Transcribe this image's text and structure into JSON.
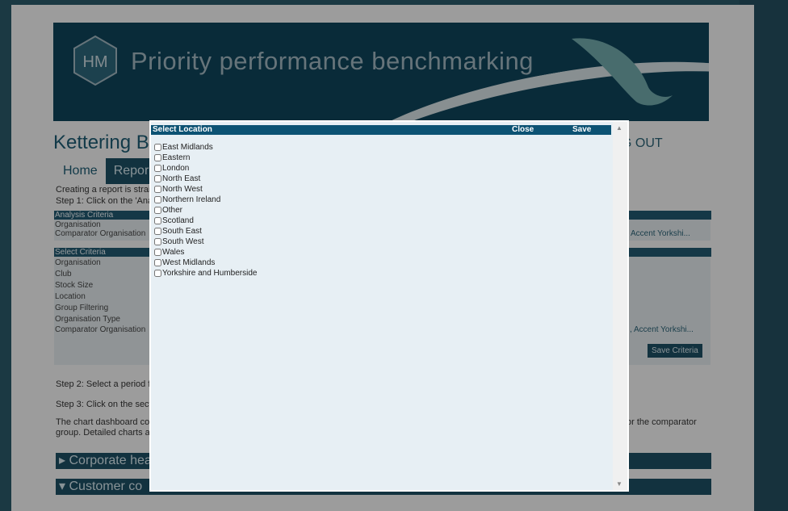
{
  "banner": {
    "title": "Priority performance benchmarking",
    "logo_text": "HM"
  },
  "page": {
    "heading": "Kettering B",
    "logout": "G OUT",
    "nav": [
      "Home",
      "Repor"
    ],
    "intro_line1": "Creating a report is strai",
    "intro_line2": "Step 1: Click on the 'Ana",
    "analysis_header": "Analysis Criteria",
    "analysis_rows": [
      "Organisation",
      "Comparator Organisation"
    ],
    "analysis_right": "Accent Yorkshi...",
    "select_header": "Select Criteria",
    "select_rows": [
      "Organisation",
      "Club",
      "Stock Size",
      "Location",
      "Group Filtering",
      "Organisation Type",
      "Comparator Organisation"
    ],
    "select_right": ", Accent Yorkshi...",
    "save_criteria": "Save Criteria",
    "step2": "Step 2: Select a period f",
    "step3": "Step 3: Click on the sect",
    "dash_line1": "The chart dashboard co",
    "dash_line1_right": "or the comparator",
    "dash_line2": "group. Detailed charts a",
    "section1": "Corporate hea",
    "section2": "Customer co"
  },
  "modal": {
    "title": "Select Location",
    "close_label": "Close",
    "save_label": "Save",
    "locations": [
      "East Midlands",
      "Eastern",
      "London",
      "North East",
      "North West",
      "Northern Ireland",
      "Other",
      "Scotland",
      "South East",
      "South West",
      "Wales",
      "West Midlands",
      "Yorkshire and Humberside"
    ]
  },
  "colors": {
    "header_blue": "#0c5273",
    "modal_bg": "#e7eff4",
    "brand_dark": "#1d4d62"
  }
}
